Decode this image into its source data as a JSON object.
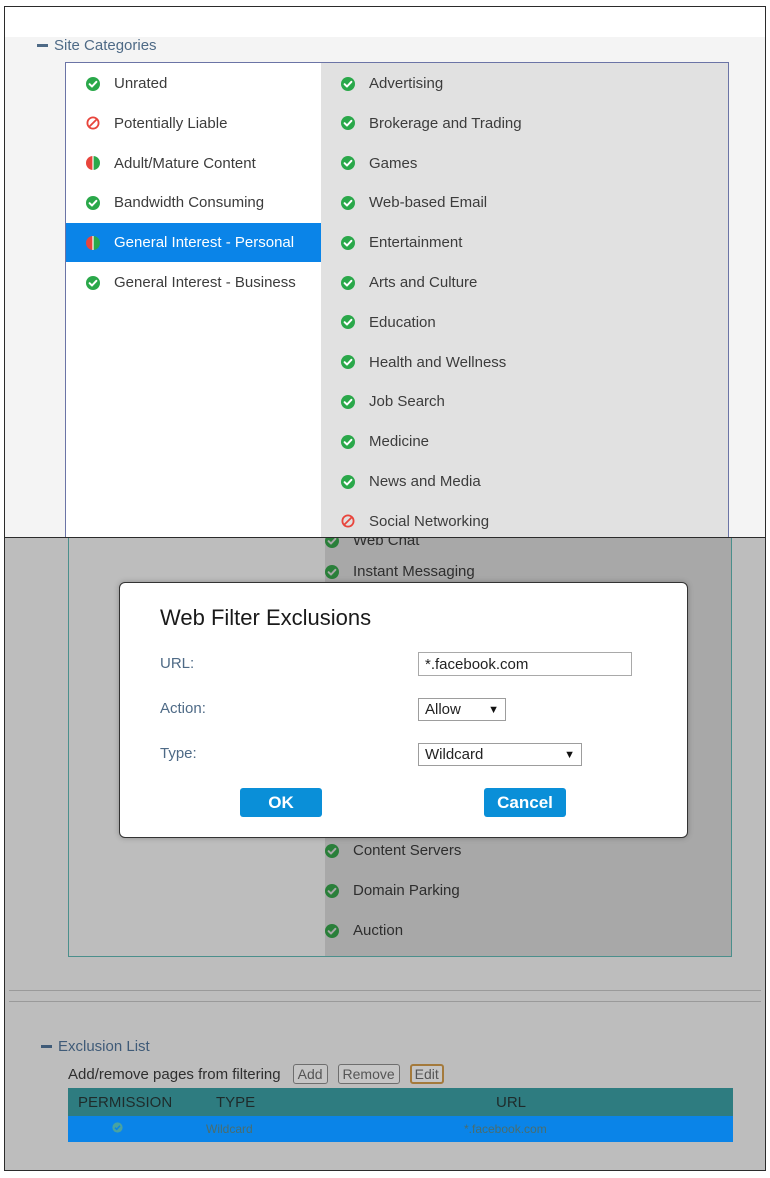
{
  "site_categories": {
    "heading": "Site Categories",
    "groups": [
      {
        "label": "Unrated",
        "status": "allowed"
      },
      {
        "label": "Potentially Liable",
        "status": "blocked"
      },
      {
        "label": "Adult/Mature Content",
        "status": "mixed"
      },
      {
        "label": "Bandwidth Consuming",
        "status": "allowed"
      },
      {
        "label": "General Interest - Personal",
        "status": "mixed",
        "selected": true
      },
      {
        "label": "General Interest - Business",
        "status": "allowed"
      }
    ],
    "categories": [
      {
        "label": "Advertising",
        "status": "allowed"
      },
      {
        "label": "Brokerage and Trading",
        "status": "allowed"
      },
      {
        "label": "Games",
        "status": "allowed"
      },
      {
        "label": "Web-based Email",
        "status": "allowed"
      },
      {
        "label": "Entertainment",
        "status": "allowed"
      },
      {
        "label": "Arts and Culture",
        "status": "allowed"
      },
      {
        "label": "Education",
        "status": "allowed"
      },
      {
        "label": "Health and Wellness",
        "status": "allowed"
      },
      {
        "label": "Job Search",
        "status": "allowed"
      },
      {
        "label": "Medicine",
        "status": "allowed"
      },
      {
        "label": "News and Media",
        "status": "allowed"
      },
      {
        "label": "Social Networking",
        "status": "blocked"
      }
    ]
  },
  "background_categories": {
    "top": [
      {
        "label": "Web Chat",
        "status": "allowed"
      },
      {
        "label": "Instant Messaging",
        "status": "allowed"
      }
    ],
    "bottom": [
      {
        "label": "Content Servers",
        "status": "allowed"
      },
      {
        "label": "Domain Parking",
        "status": "allowed"
      },
      {
        "label": "Auction",
        "status": "allowed"
      }
    ]
  },
  "dialog": {
    "title": "Web Filter Exclusions",
    "url_label": "URL:",
    "url_value": "*.facebook.com",
    "action_label": "Action:",
    "action_value": "Allow",
    "type_label": "Type:",
    "type_value": "Wildcard",
    "ok_label": "OK",
    "cancel_label": "Cancel"
  },
  "exclusion_list": {
    "heading": "Exclusion List",
    "subtitle": "Add/remove pages from filtering",
    "add_label": "Add",
    "remove_label": "Remove",
    "edit_label": "Edit",
    "columns": [
      "PERMISSION",
      "TYPE",
      "URL"
    ],
    "rows": [
      {
        "permission": "allowed",
        "type": "Wildcard",
        "url": "*.facebook.com"
      }
    ]
  },
  "colors": {
    "allowed": "#2aa84a",
    "blocked": "#e8453c",
    "mixed_left": "#e8453c",
    "mixed_right": "#2aa84a",
    "selection": "#0a84e8",
    "button": "#0a8fd8"
  }
}
